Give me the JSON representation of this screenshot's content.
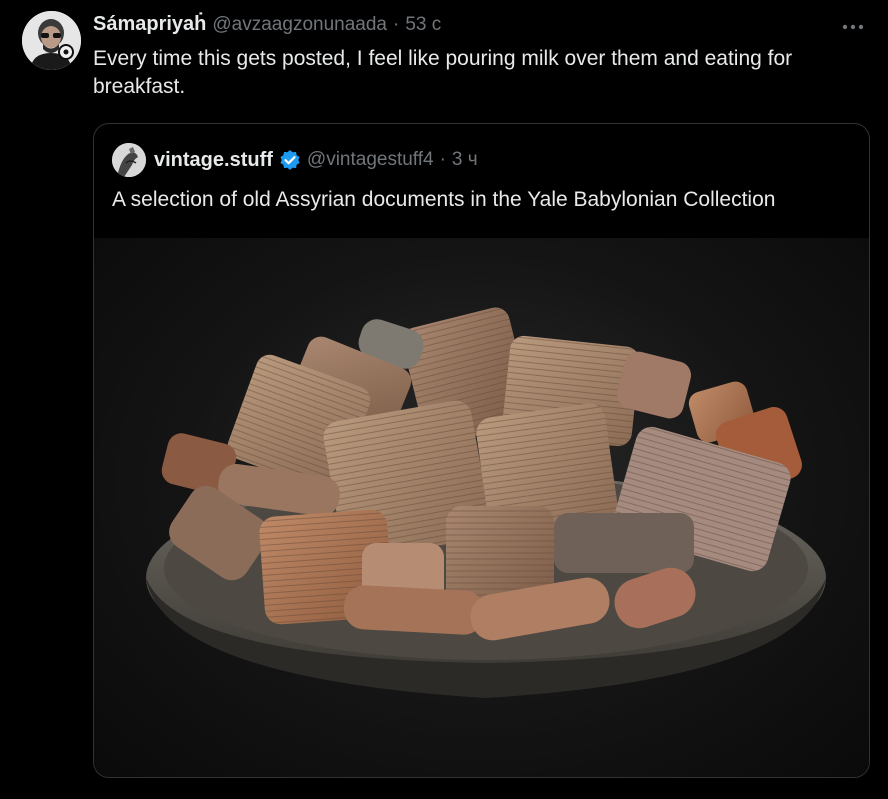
{
  "post": {
    "display_name": "Sámapriyaḣ",
    "handle": "@avzaagzonunaada",
    "separator": "·",
    "time": "53 с",
    "more_label": "···",
    "text": "Every time this gets posted, I feel like pouring milk over them and eating for breakfast."
  },
  "quote": {
    "display_name": "vintage.stuff",
    "handle": "@vintagestuff4",
    "separator": "·",
    "time": "3 ч",
    "text": "A selection of old Assyrian documents in the Yale Babylonian Collection",
    "verified_icon": "verified-badge-icon",
    "verified_color": "#1d9bf0"
  },
  "colors": {
    "background": "#000000",
    "primary_text": "#e7e9ea",
    "secondary_text": "#71767b",
    "border": "#2f3336"
  }
}
